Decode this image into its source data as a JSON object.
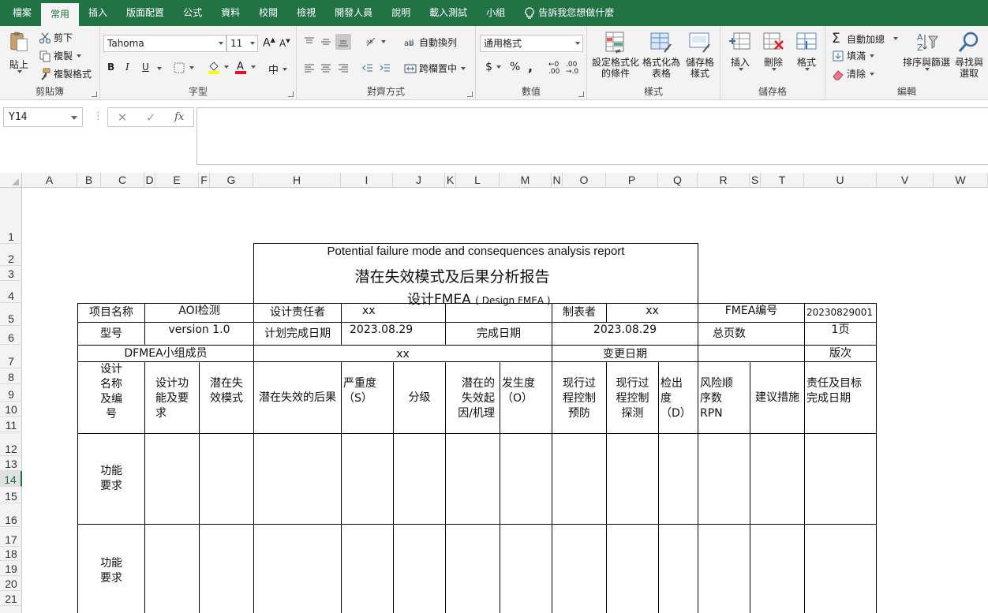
{
  "tabs": [
    "檔案",
    "常用",
    "插入",
    "版面配置",
    "公式",
    "資料",
    "校閱",
    "檢視",
    "開發人員",
    "說明",
    "載入測試",
    "小組"
  ],
  "tell_me": "告訴我您想做什麼",
  "ribbon": {
    "clipboard": {
      "paste": "貼上",
      "cut": "剪下",
      "copy": "複製",
      "format_painter": "複製格式",
      "label": "剪貼簿"
    },
    "font": {
      "font_name": "Tahoma",
      "font_size": "11",
      "bold": "B",
      "italic": "I",
      "underline": "U",
      "label": "字型",
      "font_color_hex": "#e81123",
      "fill_color_hex": "#ffff00"
    },
    "alignment": {
      "wrap": "自動換列",
      "merge": "跨欄置中",
      "label": "對齊方式"
    },
    "number": {
      "format": "通用格式",
      "currency": "$",
      "percent": "%",
      "comma": ",",
      "label": "數值"
    },
    "styles": {
      "cond_format": "設定格式化的條件",
      "format_table": "格式化為表格",
      "cell_styles": "儲存格樣式",
      "label": "樣式"
    },
    "cells": {
      "insert": "插入",
      "delete": "刪除",
      "format": "格式",
      "label": "儲存格"
    },
    "editing": {
      "autosum": "自動加總",
      "fill": "填滿",
      "clear": "清除",
      "sort": "排序與篩選",
      "find": "尋找與選取",
      "label": "編輯"
    }
  },
  "formula_bar": {
    "name_box": "Y14",
    "cancel": "✕",
    "enter": "✓",
    "fx": "fx",
    "content": ""
  },
  "columns": [
    "A",
    "B",
    "C",
    "D",
    "E",
    "F",
    "G",
    "H",
    "I",
    "J",
    "K",
    "L",
    "M",
    "N",
    "O",
    "P",
    "Q",
    "R",
    "S",
    "T",
    "U",
    "V",
    "W"
  ],
  "rows": [
    "1",
    "2",
    "3",
    "4",
    "5",
    "6",
    "7",
    "8",
    "9",
    "10",
    "11",
    "12",
    "13",
    "14",
    "15",
    "16",
    "17",
    "18",
    "19",
    "20",
    "21"
  ],
  "selected_row": "14",
  "sheet": {
    "title_en": "Potential failure mode and consequences analysis report",
    "title_cn": "潜在失效模式及后果分析报告",
    "title_sub": "设计FMEA",
    "title_sub_en": "( Design FMEA )",
    "project_name_label": "项目名称",
    "project_name": "AOI检测",
    "design_owner_label": "设计责任者",
    "design_owner": "xx",
    "maker_label": "制表者",
    "maker": "xx",
    "fmea_no_label": "FMEA编号",
    "fmea_no": "20230829001",
    "model_label": "型号",
    "model": "version 1.0",
    "plan_date_label": "计划完成日期",
    "plan_date": "2023.08.29",
    "done_date_label": "完成日期",
    "done_date": "2023.08.29",
    "total_pages_label": "总页数",
    "total_pages": "1页",
    "team_label": "DFMEA小组成员",
    "team": "xx",
    "change_date_label": "变更日期",
    "version_label": "版次",
    "headers": {
      "item": "设计\n名称\n及编\n号",
      "function": "设计功\n能及要\n求",
      "failure_mode": "潜在失\n效模式",
      "effect": "潜在失效的后果",
      "severity": "严重度\n（S）",
      "class": "分级",
      "cause": "潜在的\n失效起\n因/机理",
      "occurrence": "发生度\n（O）",
      "prevention": "现行过\n程控制\n预防",
      "detection_ctrl": "现行过\n程控制\n探测",
      "detection": "检出\n度\n（D）",
      "rpn": "风险顺\n序数\nRPN",
      "action": "建议措施",
      "owner": "责任及目标\n完成日期"
    },
    "body_rows": [
      "功能\n要求",
      "功能\n要求"
    ]
  }
}
